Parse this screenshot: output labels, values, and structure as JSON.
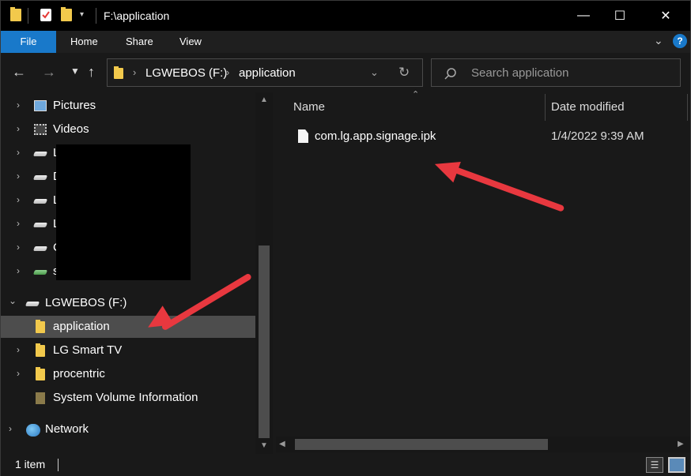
{
  "window": {
    "title": "F:\\application"
  },
  "ribbon": {
    "tabs": [
      "File",
      "Home",
      "Share",
      "View"
    ]
  },
  "address": {
    "crumbs": [
      "LGWEBOS (F:)",
      "application"
    ],
    "search_placeholder": "Search application"
  },
  "sidebar": {
    "items": [
      {
        "label": "Pictures",
        "icon": "pictures-icon"
      },
      {
        "label": "Videos",
        "icon": "videos-icon"
      },
      {
        "label": "L",
        "icon": "drive-icon"
      },
      {
        "label": "D",
        "icon": "drive-icon"
      },
      {
        "label": "L",
        "icon": "drive-icon"
      },
      {
        "label": "L",
        "icon": "drive-icon"
      },
      {
        "label": "C",
        "icon": "drive-icon"
      },
      {
        "label": "s",
        "icon": "drive-icon"
      },
      {
        "label": "LGWEBOS (F:)",
        "icon": "drive-icon"
      },
      {
        "label": "application",
        "icon": "folder-icon"
      },
      {
        "label": "LG Smart TV",
        "icon": "folder-icon"
      },
      {
        "label": "procentric",
        "icon": "folder-icon"
      },
      {
        "label": "System Volume Information",
        "icon": "folder-icon"
      },
      {
        "label": "Network",
        "icon": "network-icon"
      }
    ]
  },
  "content": {
    "columns": [
      "Name",
      "Date modified"
    ],
    "files": [
      {
        "name": "com.lg.app.signage.ipk",
        "date_modified": "1/4/2022 9:39 AM"
      }
    ]
  },
  "status": {
    "text": "1 item"
  },
  "colors": {
    "accent": "#1979ca",
    "annotation": "#e8383f",
    "folder": "#f2c94c"
  }
}
